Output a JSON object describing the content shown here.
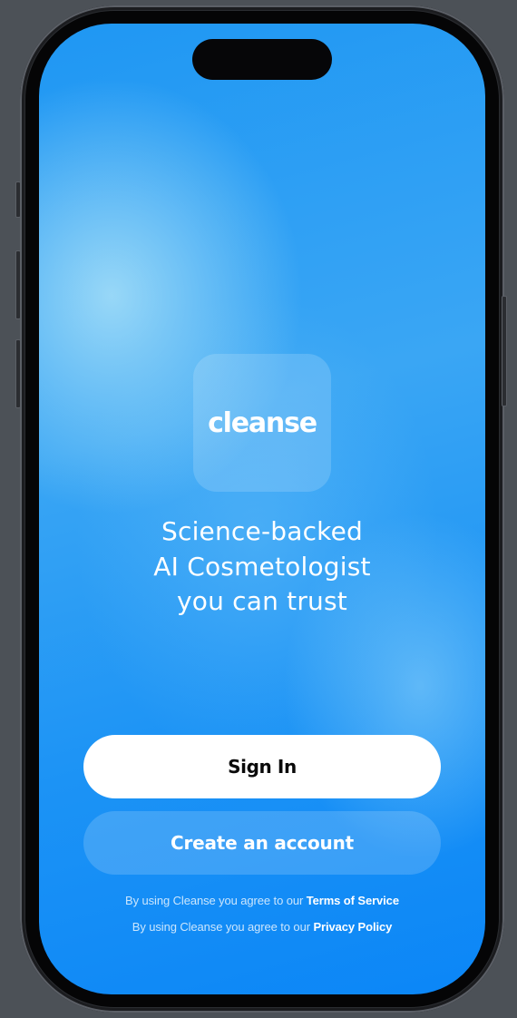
{
  "app": {
    "logo_text": "cleanse",
    "tagline_lines": [
      "Science-backed",
      "AI Cosmetologist",
      "you can trust"
    ]
  },
  "actions": {
    "sign_in_label": "Sign In",
    "create_account_label": "Create an account"
  },
  "legal": {
    "prefix": "By using Cleanse you agree to our",
    "terms_label": "Terms of Service",
    "privacy_label": "Privacy Policy"
  },
  "colors": {
    "background_blue": "#1c93f5",
    "primary_button": "#ffffff",
    "text_light": "#ffffff"
  }
}
